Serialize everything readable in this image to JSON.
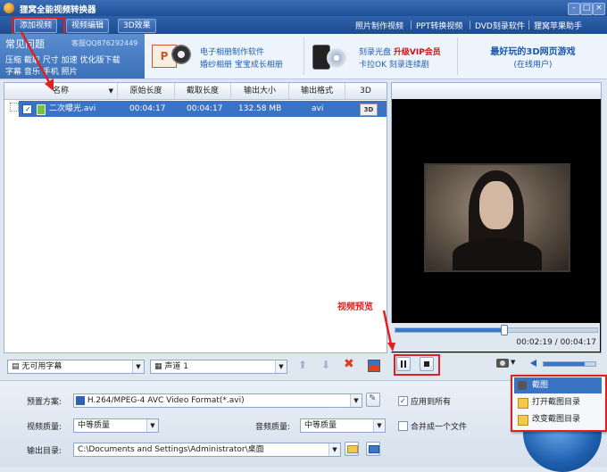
{
  "window": {
    "title": "狸窝全能视频转换器",
    "controls": [
      "-",
      "□",
      "×"
    ]
  },
  "toolbar": {
    "add_video": "添加视频",
    "edit_video": "视频编辑",
    "effect_3d": "3D效果",
    "links": [
      "照片制作视频",
      "PPT转换视频",
      "DVD刻录软件",
      "狸窝苹果助手"
    ]
  },
  "faq": {
    "title": "常见问题",
    "service": "客服QQ876292449",
    "links_row1": [
      "压缩",
      "截取",
      "尺寸",
      "加速",
      "优化版下载"
    ],
    "links_row2": [
      "字幕",
      "音乐",
      "手机",
      "照片"
    ]
  },
  "ads": {
    "ad1_line1": "电子相册制作软件",
    "ad1_line2": "婚纱相册  宝宝成长相册",
    "ad2_line1": "刻录光盘",
    "ad2_vip": "升级VIP会员",
    "ad2_line2": "卡拉OK  刻录连续剧",
    "ad3_line1": "最好玩的3D网页游戏",
    "ad3_line2": "(在线用户)"
  },
  "table": {
    "columns": [
      "名称",
      "原始长度",
      "截取长度",
      "输出大小",
      "输出格式",
      "3D"
    ],
    "rows": [
      {
        "name": "二次曝光.avi",
        "orig_len": "00:04:17",
        "cut_len": "00:04:17",
        "size": "132.58 MB",
        "format": "avi",
        "three_d": "3D"
      }
    ]
  },
  "annotation": {
    "preview_label": "视频预览"
  },
  "preview": {
    "time": "00:02:19 / 00:04:17",
    "progress": 0.54,
    "volume": 0.8
  },
  "listbar": {
    "subtitle": "无可用字幕",
    "audio_track": "声道 1"
  },
  "settings": {
    "preset_label": "预置方案:",
    "preset_value": "H.264/MPEG-4 AVC Video Format(*.avi)",
    "apply_all": "应用到所有",
    "video_quality_label": "视频质量:",
    "video_quality": "中等质量",
    "audio_quality_label": "音频质量:",
    "audio_quality": "中等质量",
    "merge": "合并成一个文件",
    "output_label": "输出目录:",
    "output_path": "C:\\Documents and Settings\\Administrator\\桌面"
  },
  "context_menu": {
    "items": [
      "截图",
      "打开截图目录",
      "改变截图目录"
    ]
  },
  "colors": {
    "titlebar": "#1f4f96",
    "selection": "#3a72c4",
    "annotation": "#e02020"
  }
}
